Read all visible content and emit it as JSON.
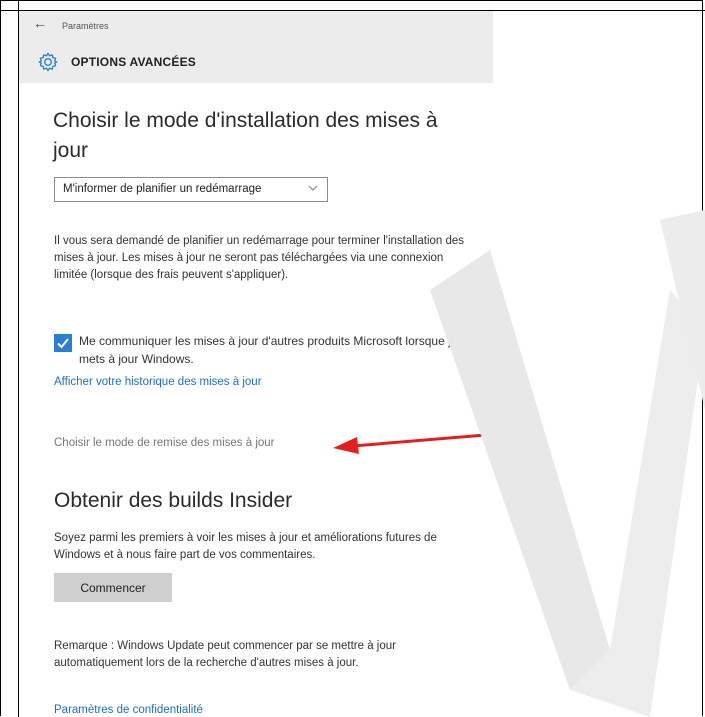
{
  "topbar": {
    "back_icon": "back-arrow-icon",
    "breadcrumb": "Paramètres",
    "section_icon": "gear-icon",
    "section_title": "OPTIONS AVANCÉES"
  },
  "main": {
    "heading": "Choisir le mode d'installation des mises à jour",
    "install_mode_select": {
      "selected": "M'informer de planifier un redémarrage",
      "chevron_icon": "chevron-down-icon"
    },
    "install_description": "Il vous sera demandé de planifier un redémarrage pour terminer l'installation des mises à jour. Les mises à jour ne seront pas téléchargées via une connexion limitée (lorsque des frais peuvent s'appliquer).",
    "microsoft_updates_checkbox": {
      "checked": true,
      "label": "Me communiquer les mises à jour d'autres produits Microsoft lorsque je mets à jour Windows."
    },
    "history_link": "Afficher votre historique des mises à jour",
    "delivery_link": "Choisir le mode de remise des mises à jour"
  },
  "insider": {
    "heading": "Obtenir des builds Insider",
    "description": "Soyez parmi les premiers à voir les mises à jour et améliorations futures de Windows et à nous faire part de vos commentaires.",
    "start_button": "Commencer",
    "note": "Remarque : Windows Update peut commencer par se mettre à jour automatiquement lors de la recherche d'autres mises à jour.",
    "privacy_link": "Paramètres de confidentialité"
  },
  "colors": {
    "accent": "#2a7fd4",
    "link": "#1e6fc2",
    "annotation_arrow": "#e0201f",
    "topbar_bg": "#ececec",
    "button_bg": "#cfcfcf"
  }
}
